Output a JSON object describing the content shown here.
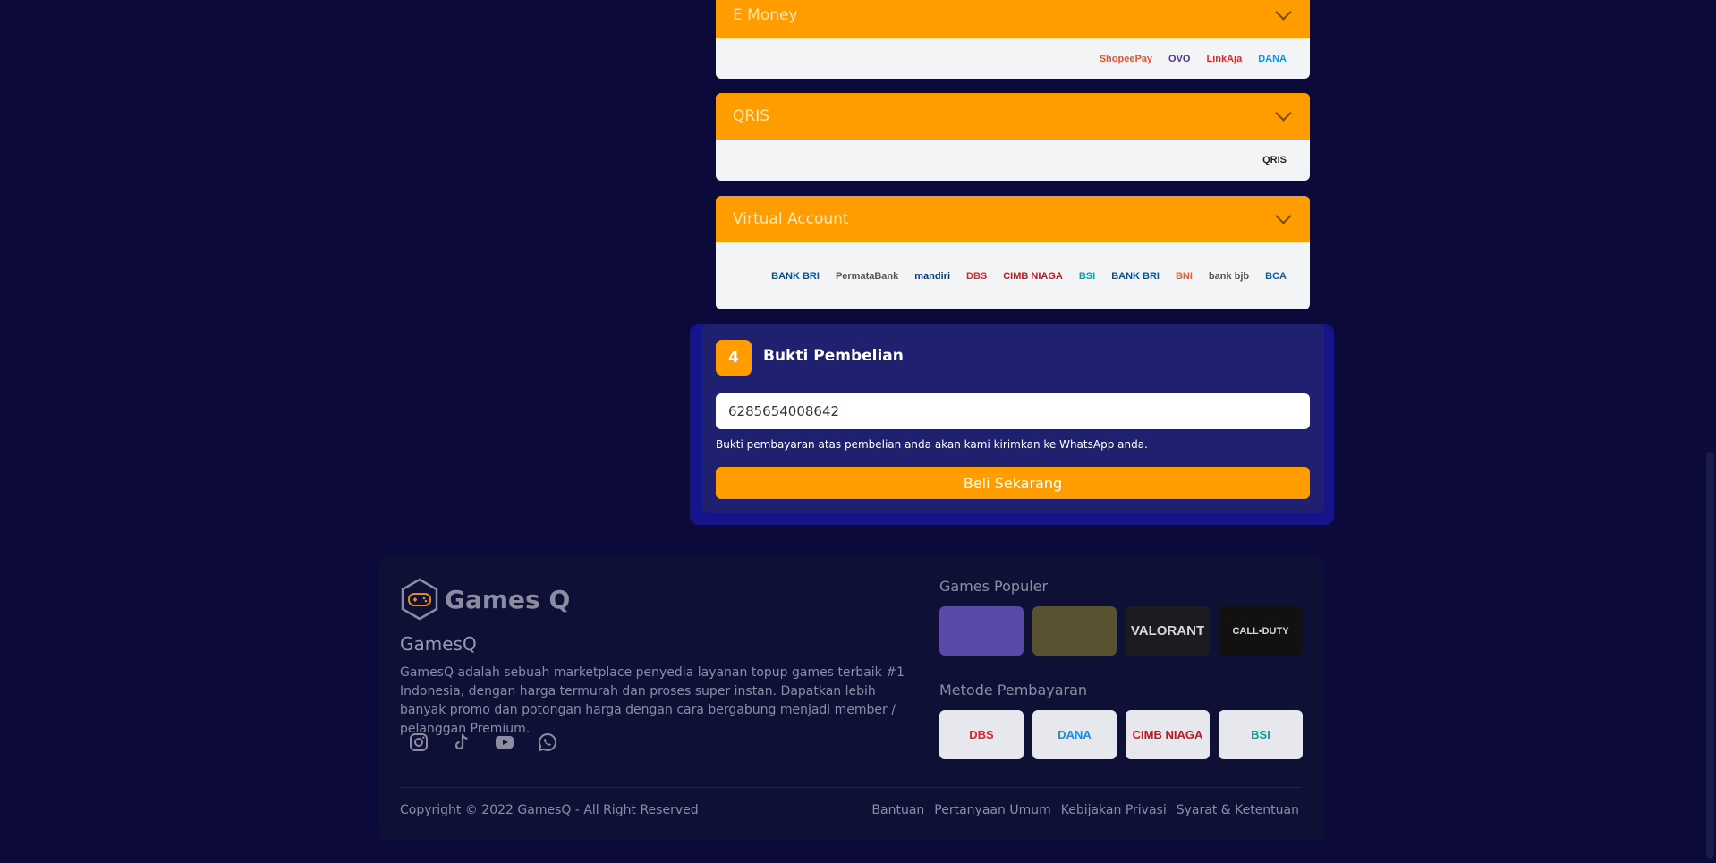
{
  "payment_methods": [
    {
      "label": "E Money",
      "logos": [
        {
          "name": "ShopeePay",
          "color": "#ee4d2d"
        },
        {
          "name": "OVO",
          "color": "#4c3494"
        },
        {
          "name": "LinkAja",
          "color": "#e82529"
        },
        {
          "name": "DANA",
          "color": "#118ee9"
        }
      ]
    },
    {
      "label": "QRIS",
      "logos": [
        {
          "name": "QRIS",
          "color": "#222222"
        }
      ]
    },
    {
      "label": "Virtual Account",
      "logos": [
        {
          "name": "BANK BRI",
          "color": "#00529c"
        },
        {
          "name": "PermataBank",
          "color": "#555555"
        },
        {
          "name": "mandiri",
          "color": "#003d79"
        },
        {
          "name": "DBS",
          "color": "#e41e26"
        },
        {
          "name": "CIMB NIAGA",
          "color": "#c4161c"
        },
        {
          "name": "BSI",
          "color": "#00a39d"
        },
        {
          "name": "BANK BRI",
          "color": "#00529c"
        },
        {
          "name": "BNI",
          "color": "#f15a23"
        },
        {
          "name": "bank bjb",
          "color": "#555555"
        },
        {
          "name": "BCA",
          "color": "#0060af"
        }
      ]
    }
  ],
  "section4": {
    "step": "4",
    "title": "Bukti Pembelian",
    "phone_value": "6285654008642",
    "hint": "Bukti pembayaran atas pembelian anda akan kami kirimkan ke WhatsApp anda.",
    "buy_label": "Beli Sekarang"
  },
  "footer": {
    "brand": "Games Q",
    "company": "GamesQ",
    "description": "GamesQ adalah sebuah marketplace penyedia layanan topup games terbaik #1 Indonesia, dengan harga termurah dan proses super instan. Dapatkan lebih banyak promo dan potongan harga dengan cara bergabung menjadi member / pelanggan Premium.",
    "socials": [
      "instagram-icon",
      "tiktok-icon",
      "youtube-icon",
      "whatsapp-icon"
    ],
    "popular_title": "Games Populer",
    "popular_games": [
      {
        "name": "",
        "bg": "#5a4aa8"
      },
      {
        "name": "",
        "bg": "#5a5130"
      },
      {
        "name": "VALORANT",
        "bg": "#1b1b22"
      },
      {
        "name": "CALL•DUTY",
        "bg": "#111111"
      }
    ],
    "methods_title": "Metode Pembayaran",
    "methods": [
      {
        "name": "DBS",
        "color": "#e41e26"
      },
      {
        "name": "DANA",
        "color": "#118ee9"
      },
      {
        "name": "CIMB NIAGA",
        "color": "#c4161c"
      },
      {
        "name": "BSI",
        "color": "#00a39d"
      }
    ],
    "copyright": "Copyright © 2022 GamesQ - All Right Reserved",
    "links": [
      "Bantuan",
      "Pertanyaan Umum",
      "Kebijakan Privasi",
      "Syarat & Ketentuan"
    ]
  },
  "colors": {
    "background": "#0c0a3a",
    "accent": "#ff9d00",
    "panel": "#1f2070"
  }
}
